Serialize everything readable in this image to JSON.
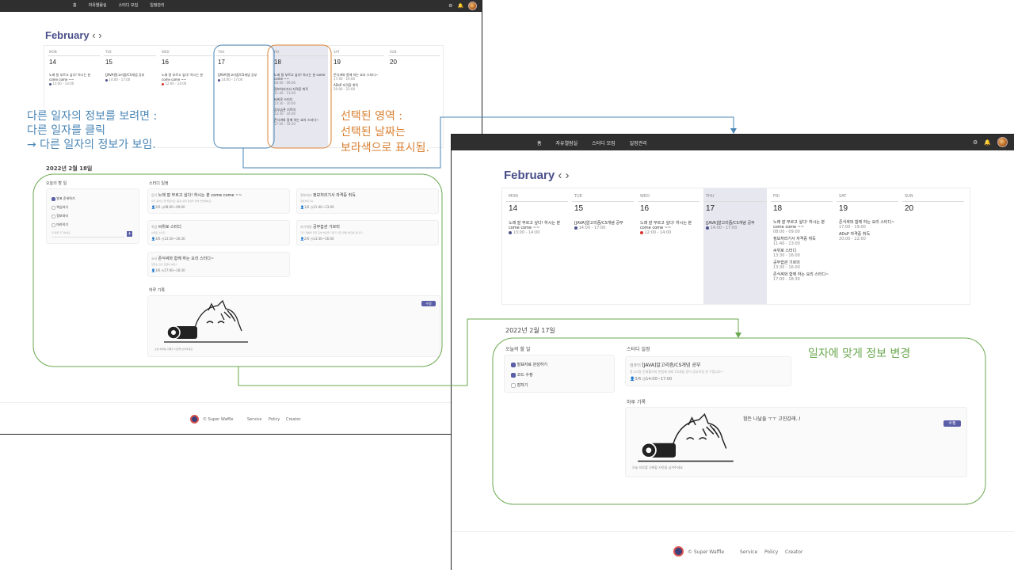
{
  "nav": {
    "links": [
      "홈",
      "자유열람실",
      "스터디 모집",
      "일정관리"
    ]
  },
  "icons": {
    "settings": "gear-icon",
    "notifications": "bell-icon"
  },
  "calendar": {
    "month": "February",
    "prev": "‹",
    "next": "›",
    "days": [
      {
        "name": "MON",
        "num": "14"
      },
      {
        "name": "TUE",
        "num": "15"
      },
      {
        "name": "WED",
        "num": "16"
      },
      {
        "name": "THU",
        "num": "17"
      },
      {
        "name": "FRI",
        "num": "18"
      },
      {
        "name": "SAT",
        "num": "19"
      },
      {
        "name": "SUN",
        "num": "20"
      }
    ],
    "events": {
      "mon": {
        "title": "노래 잘 부르고 싶다! 하시는 분 come come ~~",
        "time": "13:00 - 14:00"
      },
      "tue": {
        "title": "[JAVA]알고리즘/CS개념 공부",
        "time": "14:00 - 17:00"
      },
      "wed": {
        "title": "노래 잘 부르고 싶다! 하시는 분 come come ~~",
        "time": "12:00 - 14:00"
      },
      "thu": {
        "title": "[JAVA]알고리즘/CS개념 공부",
        "time": "14:00 - 17:00"
      },
      "fri1": {
        "title": "노래 잘 부르고 싶다! 하시는 분 come come ~~",
        "time": "08:00 - 09:00"
      },
      "fri2": {
        "title": "정보처리기사 자격증 취득",
        "time": "11:40 - 13:00"
      },
      "fri3": {
        "title": "씨위로 스터디",
        "time": "13:30 - 16:00"
      },
      "fri4": {
        "title": "공부습관 기르미",
        "time": "13:30 - 16:00"
      },
      "fri5": {
        "title": "존식쌰와 함께 하는 요리 스터디~",
        "time": "17:00 - 18:30"
      },
      "sat1": {
        "title": "존식쌰와 함께 하는 요리 스터디~",
        "time": "17:00 - 19:00"
      },
      "sat2": {
        "title": "ADsP 자격증 취득",
        "time": "20:00 - 22:00"
      }
    }
  },
  "colors": {
    "accent": "#5b5fa8",
    "selected_day": "#e6e7ef",
    "nav": "#2f2f2f",
    "blue_annot": "#4a86b5",
    "orange_annot": "#d98032",
    "green_annot": "#6aa84f"
  },
  "left_detail": {
    "date": "2022년 2월 18일",
    "todo_title": "오늘의 할 일",
    "todos": [
      "발표 준비하기",
      "복습하기",
      "정보처리",
      "마라히기"
    ],
    "todo_placeholder": "할 일을 추가하세요",
    "study_title": "스터디 일정",
    "studies": [
      {
        "tag": "음악",
        "title": "노래 잘 부르고 싶다! 하시는 분 come come ~~",
        "desc": "내가 음치인 줄 몰랐어요! 음정 실력 향상을 위해 연습해봐요!",
        "count": "2/6",
        "time": "08:00~09:00"
      },
      {
        "tag": "정보처리",
        "title": "정보처리기사 자격증 취득",
        "desc": "정보처리기사",
        "count": "1/6",
        "time": "11:40~13:00"
      },
      {
        "tag": "취업",
        "title": "씨위로 스터디",
        "desc": "씨위로 스터디",
        "count": "3/6",
        "time": "13:30~16:30"
      },
      {
        "tag": "자기계발",
        "title": "공부습관 기르미",
        "desc": "자기 계발을 위한 공부 습관을 기르기 위한 매일 체크를 합니다!",
        "count": "2/6",
        "time": "13:30~16:00"
      },
      {
        "tag": "요리",
        "title": "존식쌰와 함께 하는 요리 스터디~",
        "desc": "맛있는 요리 만들어 봐요!!",
        "count": "3/6",
        "time": "17:00~18:30"
      }
    ],
    "diary_title": "하루 기록",
    "edit": "수정",
    "diary_caption": "오늘 하루를 기록할 사진을 남겨주세요"
  },
  "right_detail": {
    "date": "2022년 2월 17일",
    "todo_title": "오늘의 할 일",
    "todos": [
      "발표자료 완성하기",
      "코드 수정",
      "잠자기"
    ],
    "study_title": "스터디 일정",
    "study": {
      "tag": "컴퓨터",
      "title": "[JAVA]알고리즘/CS개념 공부",
      "desc": "알고리즘 문제풀이와 면접에 대비 CS개념 같이 공부하실 분 구합니다~",
      "count": "0/6",
      "time": "14:00~17:00"
    },
    "diary_title": "하루 기록",
    "diary_text": "힘든 나날들 ㅜㅜ 고진감래..!",
    "edit": "수정",
    "diary_caption": "오늘 하루를 기록할 사진을 남겨주세요"
  },
  "footer": {
    "brand": "© Super Waffle",
    "links": [
      "Service",
      "Policy",
      "Creator"
    ]
  },
  "annotations": {
    "blue": "다른 일자의 정보를 보려면 :\n다른 일자를 클릭\n→ 다른 일자의 정보가 보임.",
    "orange": "선택된 영역 :\n선택된 날짜는\n보라색으로 표시됨.",
    "green": "일자에 맞게 정보 변경"
  }
}
